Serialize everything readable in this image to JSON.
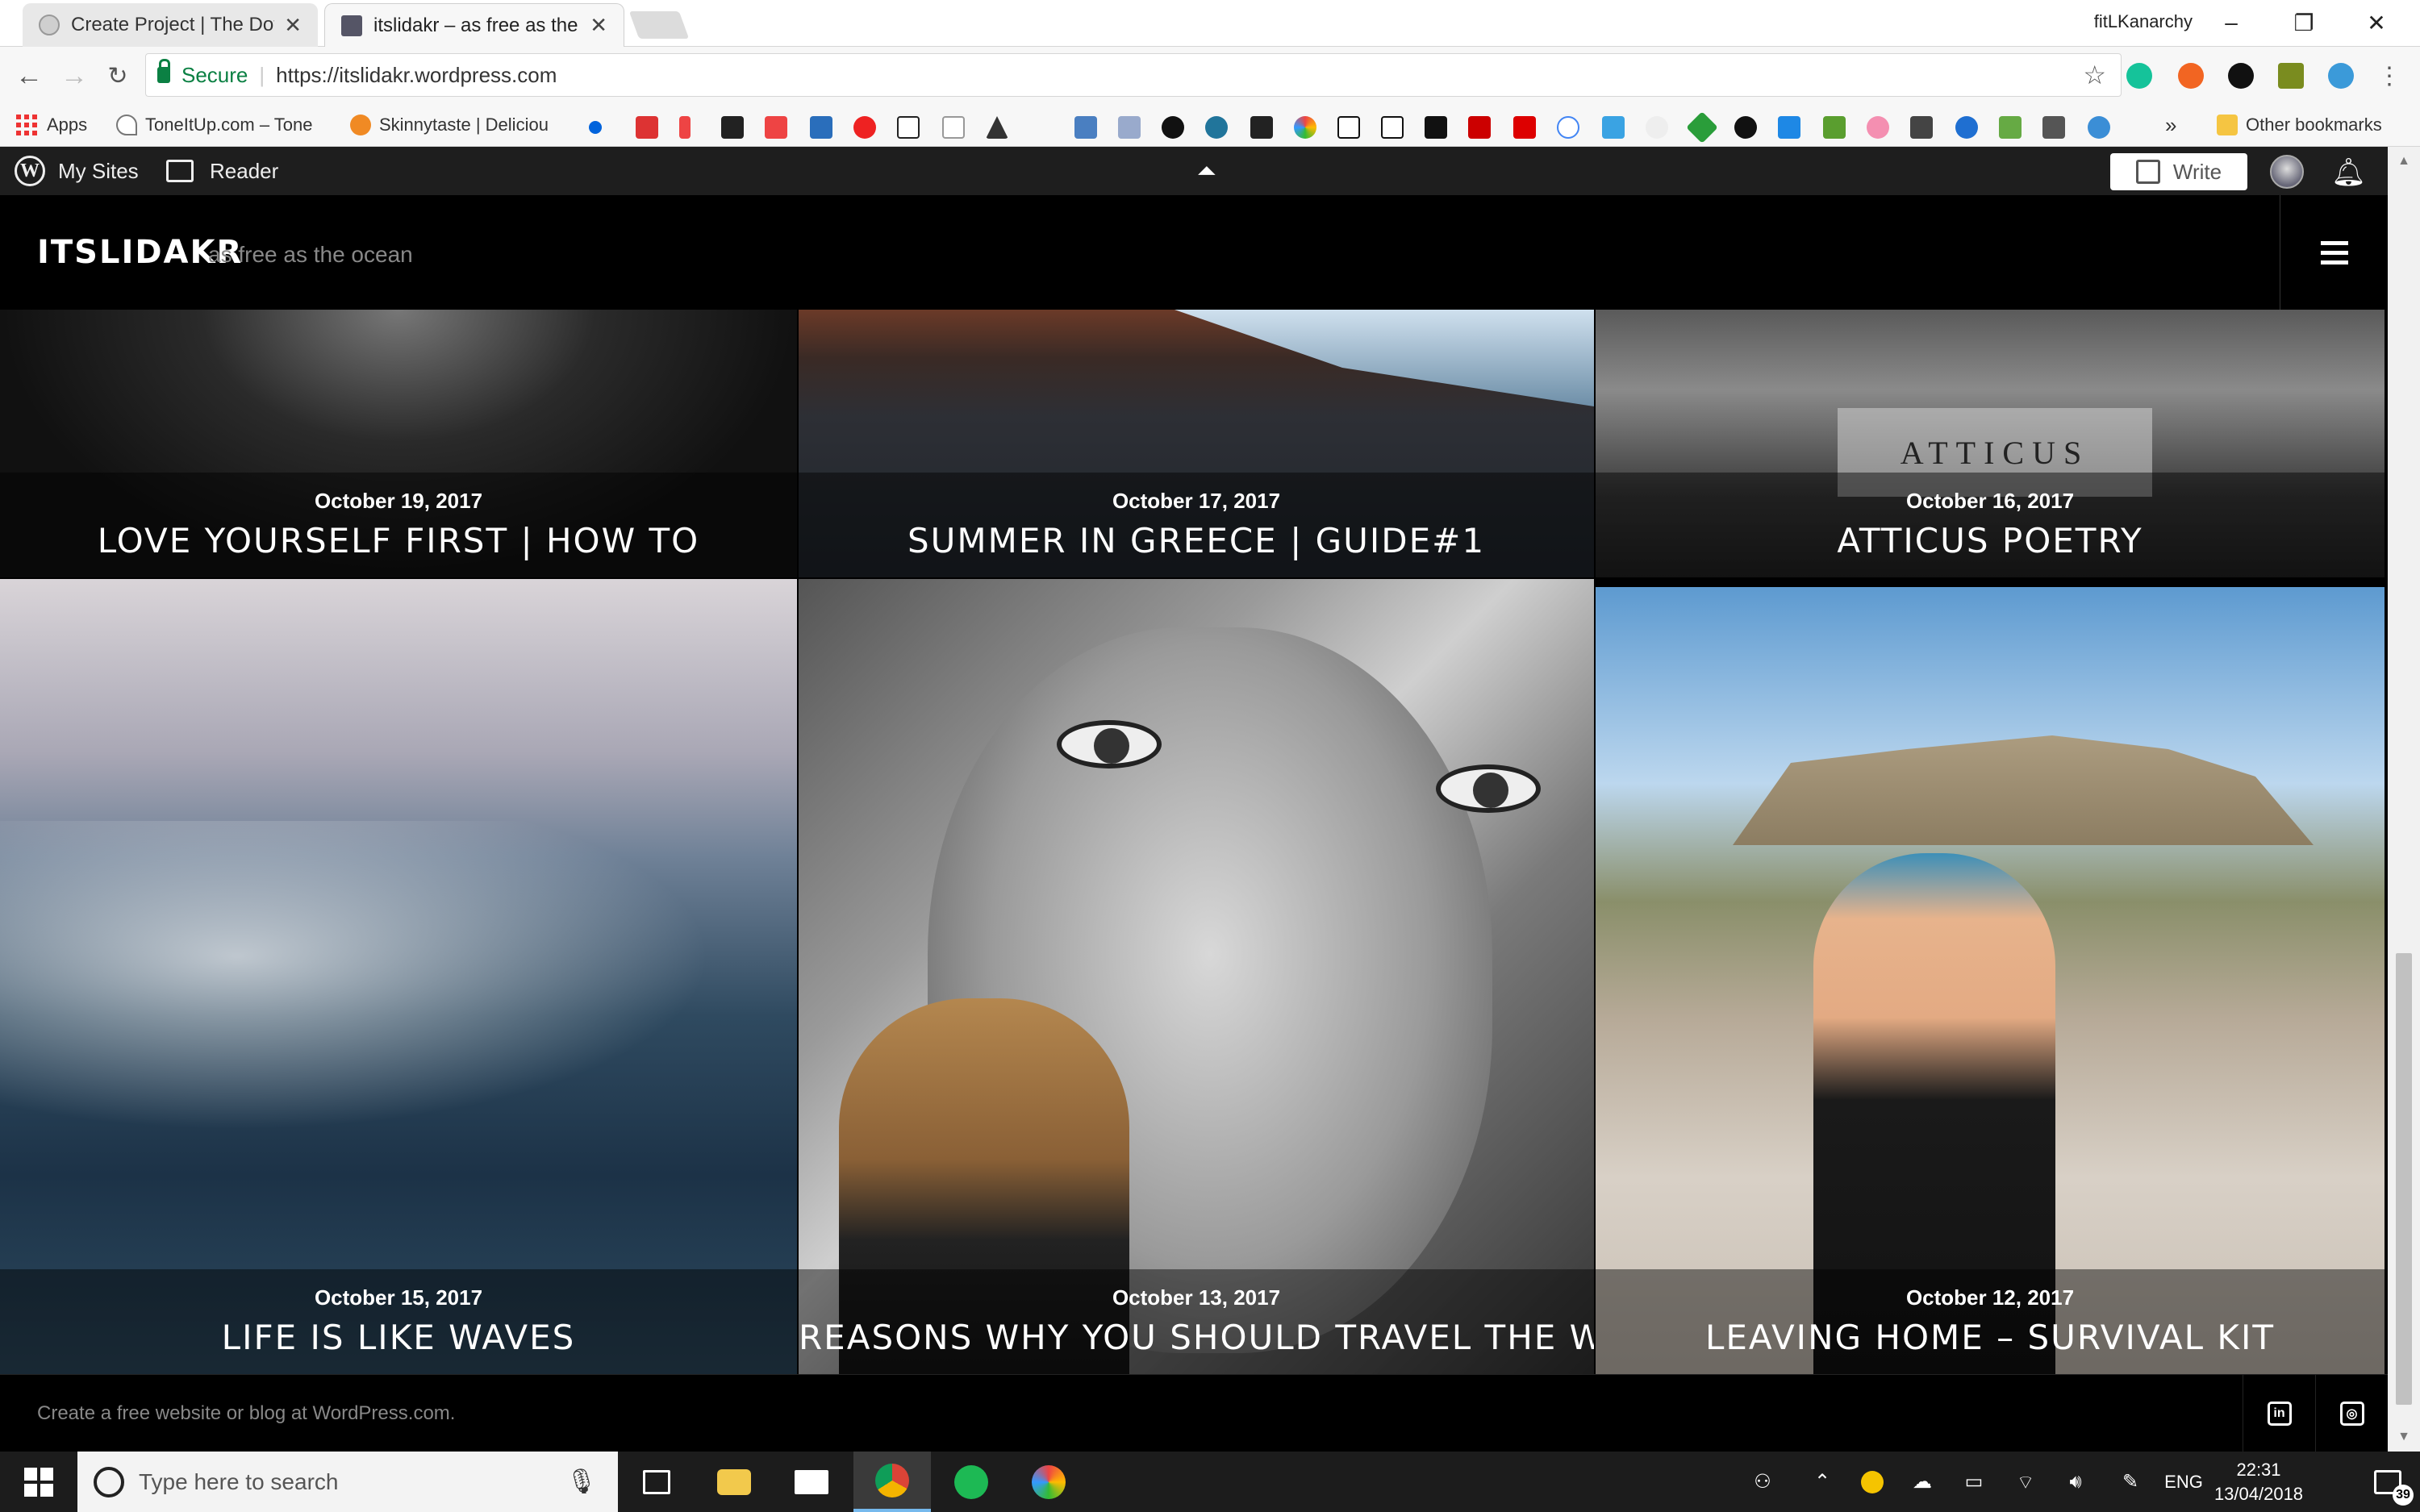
{
  "browser": {
    "tabs": [
      {
        "title": "Create Project | The Dots",
        "active": false
      },
      {
        "title": "itslidakr – as free as the o",
        "active": true
      }
    ],
    "profile_name": "fitLKanarchy",
    "secure_label": "Secure",
    "url": "https://itslidakr.wordpress.com",
    "bookmarks": [
      "Apps",
      "ToneItUp.com – Tone",
      "Skinnytaste | Deliciou"
    ],
    "more_label": "»",
    "other_bookmarks": "Other bookmarks"
  },
  "wp_admin_bar": {
    "my_sites": "My Sites",
    "reader": "Reader",
    "write": "Write"
  },
  "site": {
    "title": "ITSLIDAKR",
    "tagline": "as free as the ocean"
  },
  "posts": [
    {
      "date": "October 19, 2017",
      "title": "LOVE YOURSELF FIRST | HOW TO"
    },
    {
      "date": "October 17, 2017",
      "title": "SUMMER IN GREECE | GUIDE#1"
    },
    {
      "date": "October 16, 2017",
      "title": "ATTICUS POETRY"
    },
    {
      "date": "October 15, 2017",
      "title": "LIFE IS LIKE WAVES"
    },
    {
      "date": "October 13, 2017",
      "title": "REASONS WHY YOU SHOULD TRAVEL THE WORLD"
    },
    {
      "date": "October 12, 2017",
      "title": "LEAVING HOME – SURVIVAL KIT"
    }
  ],
  "atticus_image_text": "ATTICUS",
  "footer": {
    "credit": "Create a free website or blog at WordPress.com."
  },
  "taskbar": {
    "search_placeholder": "Type here to search",
    "language": "ENG",
    "time": "22:31",
    "date": "13/04/2018",
    "notification_count": "39"
  },
  "colors": {
    "secure_green": "#0b8043",
    "wp_bar": "#1e1e1e",
    "site_bg": "#000000"
  }
}
